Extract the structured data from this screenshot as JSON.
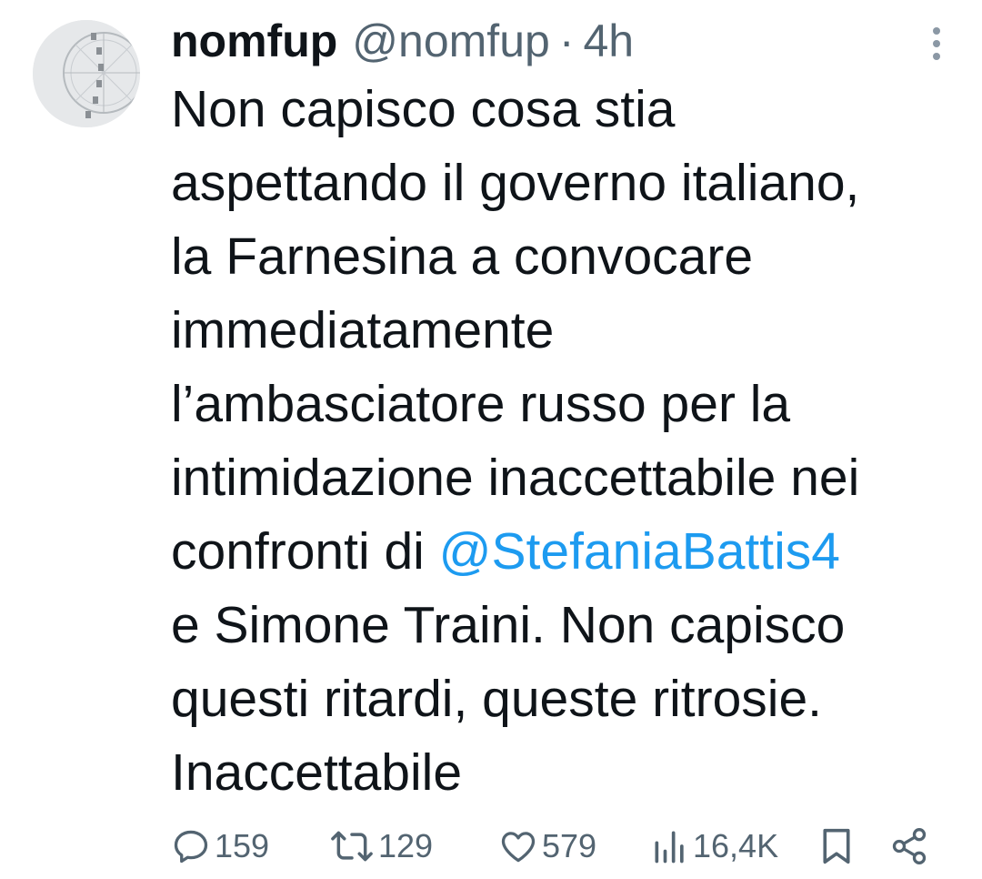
{
  "tweet": {
    "author_name": "nomfup",
    "author_handle": "@nomfup",
    "separator": "·",
    "timestamp": "4h",
    "text_lines": [
      "Non capisco cosa stia",
      "aspettando il governo italiano,",
      "la Farnesina a convocare",
      "immediatamente",
      "l’ambasciatore russo per la",
      "intimidazione inaccettabile nei"
    ],
    "line7_prefix": "confronti di ",
    "mention": "@StefaniaBattis4",
    "text_lines_after": [
      "e Simone Traini. Non capisco",
      "questi ritardi, queste ritrosie.",
      "Inaccettabile"
    ]
  },
  "actions": {
    "replies": "159",
    "reposts": "129",
    "likes": "579",
    "views": "16,4K"
  },
  "colors": {
    "text": "#0f1419",
    "secondary": "#536471",
    "mention": "#1d9bf0"
  }
}
